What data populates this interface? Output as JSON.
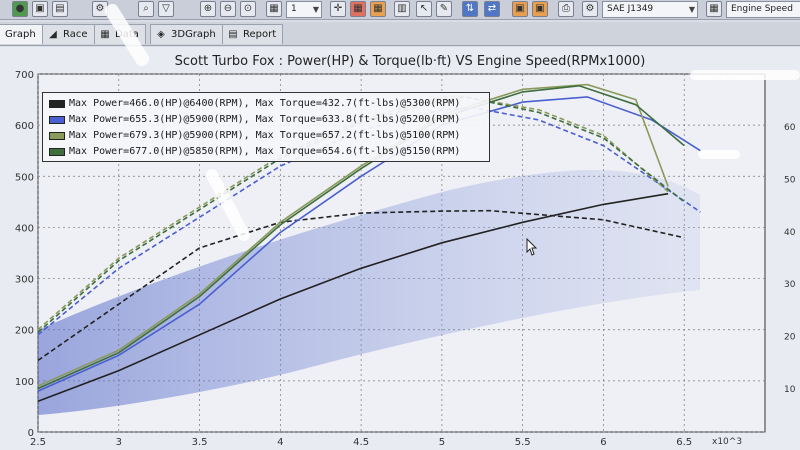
{
  "toolbar": {
    "page_value": "1",
    "standard_value": "SAE J1349",
    "axis_value": "Engine Speed"
  },
  "tabs": [
    {
      "label": "Graph",
      "active": true
    },
    {
      "label": "Race",
      "active": false
    },
    {
      "label": "Data",
      "active": false
    },
    {
      "label": "3DGraph",
      "active": false
    },
    {
      "label": "Report",
      "active": false
    }
  ],
  "chart": {
    "title": "Scott Turbo Fox : Power(HP) & Torque(lb·ft) VS Engine Speed(RPMx1000)"
  },
  "chart_data": {
    "type": "line",
    "title": "Scott Turbo Fox : Power(HP) & Torque(lb·ft) VS Engine Speed(RPMx1000)",
    "xlim": [
      2.5,
      7
    ],
    "ylim": [
      0,
      700
    ],
    "x_ticks": [
      "2.5",
      "3",
      "3.5",
      "4",
      "4.5",
      "5",
      "5.5",
      "6",
      "6.5"
    ],
    "x_exponent_label": "x10^3",
    "y_ticks": [
      "0",
      "100",
      "200",
      "300",
      "400",
      "500",
      "600",
      "700"
    ],
    "right_ticks": [
      "60",
      "50",
      "40",
      "30",
      "20",
      "10"
    ],
    "grid": true,
    "legend_position": "top-left",
    "series": [
      {
        "name": "Max Power=466.0(HP)@6400(RPM), Max Torque=432.7(ft-lbs)@5300(RPM)",
        "color": "#222222",
        "power": [
          [
            2.5,
            60
          ],
          [
            3,
            120
          ],
          [
            3.5,
            190
          ],
          [
            4,
            260
          ],
          [
            4.5,
            320
          ],
          [
            5,
            370
          ],
          [
            5.5,
            410
          ],
          [
            6,
            445
          ],
          [
            6.4,
            466
          ]
        ],
        "torque": [
          [
            2.5,
            140
          ],
          [
            3,
            250
          ],
          [
            3.5,
            360
          ],
          [
            4,
            410
          ],
          [
            4.5,
            428
          ],
          [
            5,
            432
          ],
          [
            5.3,
            432.7
          ],
          [
            6,
            415
          ],
          [
            6.5,
            380
          ]
        ]
      },
      {
        "name": "Max Power=655.3(HP)@5900(RPM), Max Torque=633.8(ft-lbs)@5200(RPM)",
        "color": "#4a5fd0",
        "power": [
          [
            2.5,
            80
          ],
          [
            3,
            150
          ],
          [
            3.5,
            250
          ],
          [
            4,
            390
          ],
          [
            4.5,
            500
          ],
          [
            5,
            600
          ],
          [
            5.5,
            645
          ],
          [
            5.9,
            655.3
          ],
          [
            6.3,
            610
          ],
          [
            6.6,
            550
          ]
        ],
        "torque": [
          [
            2.5,
            190
          ],
          [
            3,
            320
          ],
          [
            3.5,
            420
          ],
          [
            4,
            520
          ],
          [
            4.5,
            590
          ],
          [
            5,
            630
          ],
          [
            5.2,
            633.8
          ],
          [
            5.6,
            610
          ],
          [
            6,
            560
          ],
          [
            6.6,
            430
          ]
        ]
      },
      {
        "name": "Max Power=679.3(HP)@5900(RPM), Max Torque=657.2(ft-lbs)@5100(RPM)",
        "color": "#8a9a5a",
        "power": [
          [
            2.5,
            90
          ],
          [
            3,
            160
          ],
          [
            3.5,
            270
          ],
          [
            4,
            410
          ],
          [
            4.5,
            520
          ],
          [
            5,
            620
          ],
          [
            5.5,
            670
          ],
          [
            5.9,
            679.3
          ],
          [
            6.2,
            650
          ],
          [
            6.4,
            480
          ]
        ],
        "torque": [
          [
            2.5,
            200
          ],
          [
            3,
            340
          ],
          [
            3.5,
            440
          ],
          [
            4,
            540
          ],
          [
            4.5,
            610
          ],
          [
            5,
            655
          ],
          [
            5.1,
            657.2
          ],
          [
            5.6,
            630
          ],
          [
            6,
            580
          ],
          [
            6.4,
            470
          ]
        ]
      },
      {
        "name": "Max Power=677.0(HP)@5850(RPM), Max Torque=654.6(ft-lbs)@5150(RPM)",
        "color": "#3e6e3e",
        "power": [
          [
            2.5,
            85
          ],
          [
            3,
            155
          ],
          [
            3.5,
            265
          ],
          [
            4,
            405
          ],
          [
            4.5,
            515
          ],
          [
            5,
            615
          ],
          [
            5.5,
            665
          ],
          [
            5.85,
            677
          ],
          [
            6.2,
            640
          ],
          [
            6.5,
            560
          ]
        ],
        "torque": [
          [
            2.5,
            195
          ],
          [
            3,
            335
          ],
          [
            3.5,
            435
          ],
          [
            4,
            535
          ],
          [
            4.5,
            605
          ],
          [
            5,
            650
          ],
          [
            5.15,
            654.6
          ],
          [
            5.6,
            625
          ],
          [
            6,
            575
          ],
          [
            6.5,
            450
          ]
        ]
      }
    ]
  }
}
